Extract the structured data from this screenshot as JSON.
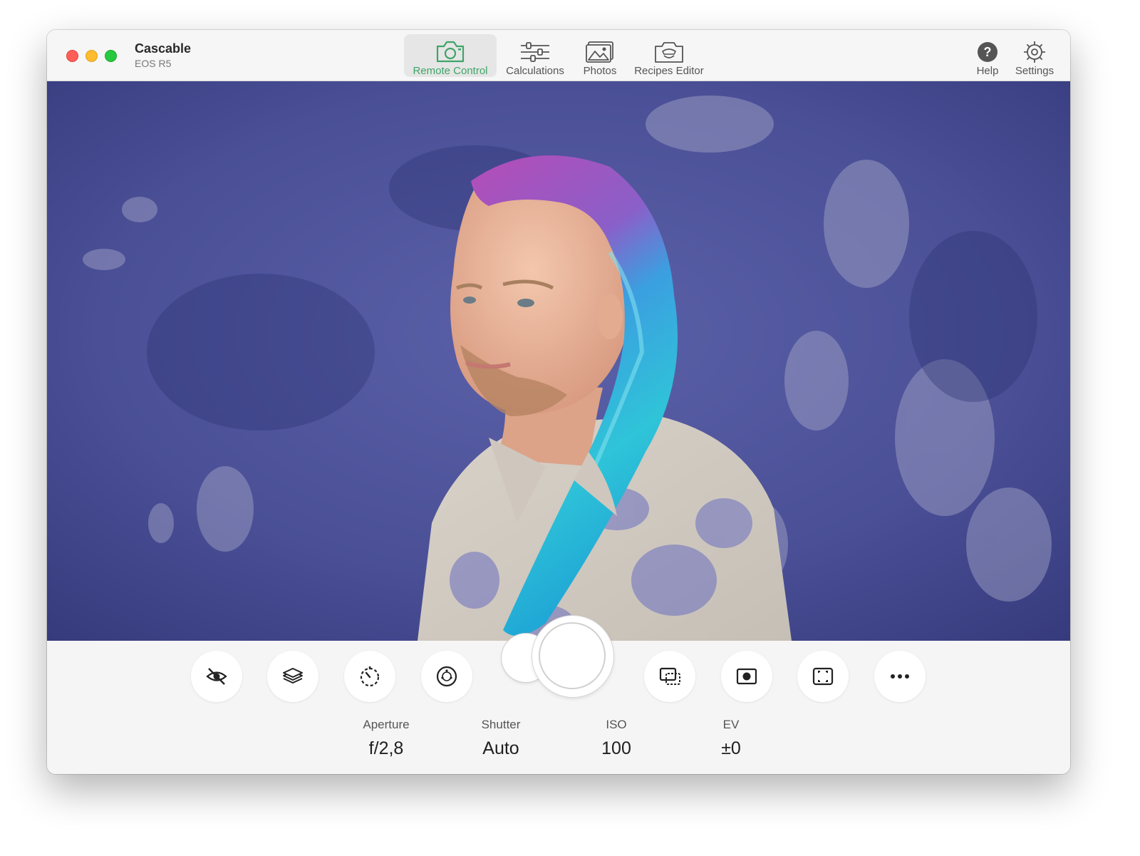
{
  "window": {
    "app_title": "Cascable",
    "camera_model": "EOS R5"
  },
  "tabs": [
    {
      "label": "Remote Control",
      "icon": "camera-icon",
      "active": true
    },
    {
      "label": "Calculations",
      "icon": "sliders-icon",
      "active": false
    },
    {
      "label": "Photos",
      "icon": "photo-stack-icon",
      "active": false
    },
    {
      "label": "Recipes Editor",
      "icon": "recipes-icon",
      "active": false
    }
  ],
  "right_tools": [
    {
      "label": "Help",
      "icon": "question-mark-icon"
    },
    {
      "label": "Settings",
      "icon": "gear-icon"
    }
  ],
  "live_view": {
    "description_icon": "live-view-image"
  },
  "control_buttons": [
    {
      "icon": "eye-slash-icon"
    },
    {
      "icon": "layers-icon"
    },
    {
      "icon": "timer-icon"
    },
    {
      "icon": "exposure-mode-dial-icon"
    },
    {
      "icon": "display-screens-icon"
    },
    {
      "icon": "metering-icon"
    },
    {
      "icon": "focus-frame-icon"
    },
    {
      "icon": "more-ellipsis-icon"
    }
  ],
  "exposure": [
    {
      "label": "Aperture",
      "value": "f/2,8"
    },
    {
      "label": "Shutter",
      "value": "Auto"
    },
    {
      "label": "ISO",
      "value": "100"
    },
    {
      "label": "EV",
      "value": "±0"
    }
  ],
  "colors": {
    "accent": "#3fa468",
    "backdrop": "#4a4f96"
  }
}
